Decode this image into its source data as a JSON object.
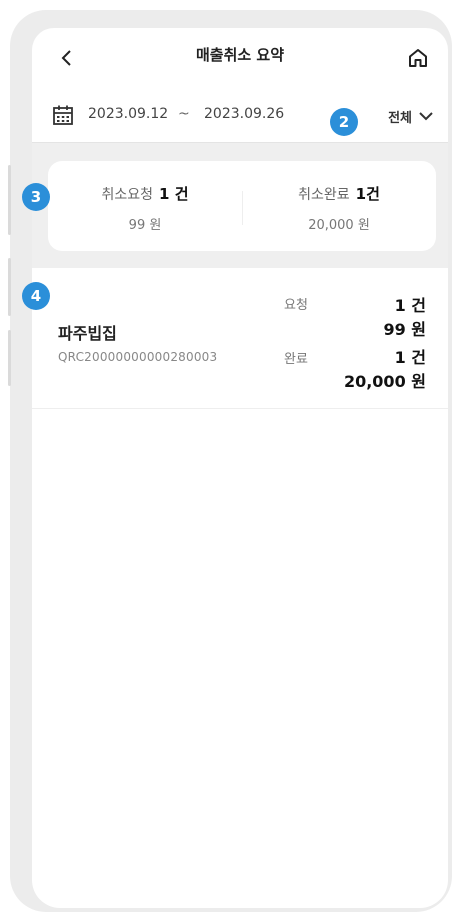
{
  "header": {
    "title": "매출취소 요약",
    "back_icon": "chevron-left-icon",
    "home_icon": "home-icon"
  },
  "date_range": {
    "start": "2023.09.12",
    "separator": "~",
    "end": "2023.09.26",
    "icon": "calendar-icon"
  },
  "filter": {
    "label": "전체",
    "icon": "chevron-down-icon"
  },
  "summary": {
    "request": {
      "label": "취소요청",
      "count": "1 건",
      "amount": "99 원"
    },
    "complete": {
      "label": "취소완료",
      "count": "1건",
      "amount": "20,000 원"
    }
  },
  "store": {
    "name": "파주빕집",
    "id": "QRC20000000000280003",
    "request": {
      "label": "요청",
      "count": "1 건",
      "amount": "99 원"
    },
    "complete": {
      "label": "완료",
      "count": "1 건",
      "amount": "20,000 원"
    }
  },
  "badges": {
    "b2": "2",
    "b3": "3",
    "b4": "4"
  },
  "colors": {
    "badge": "#2b8fd9",
    "band": "#efefef",
    "frame": "#ececec"
  }
}
